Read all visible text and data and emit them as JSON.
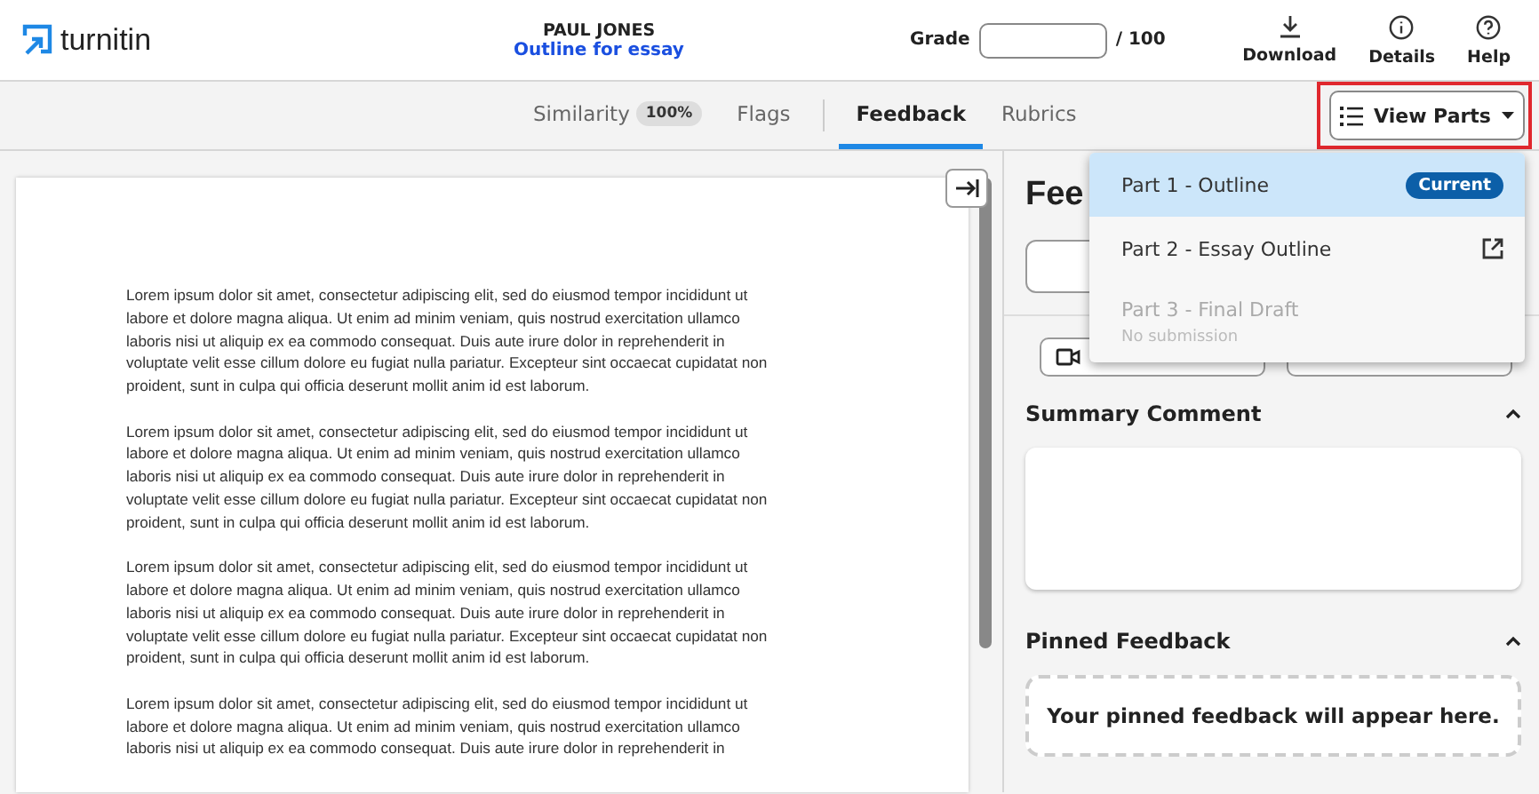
{
  "header": {
    "logo": "turnitin",
    "student": "PAUL JONES",
    "assignment": "Outline for essay",
    "grade_label": "Grade",
    "grade_max": "/ 100",
    "actions": [
      {
        "kind": "download",
        "label": "Download"
      },
      {
        "kind": "details",
        "label": "Details"
      },
      {
        "kind": "help",
        "label": "Help"
      }
    ]
  },
  "tabs": [
    {
      "label": "Similarity",
      "badge": "100%",
      "selected": false
    },
    {
      "label": "Flags",
      "selected": false
    },
    {
      "label": "Feedback",
      "selected": true
    },
    {
      "label": "Rubrics",
      "selected": false
    }
  ],
  "view_parts": {
    "label": "View Parts",
    "highlighted": true
  },
  "parts_menu": [
    {
      "label": "Part 1 - Outline",
      "selected": true,
      "disabled": false,
      "badge": "Current"
    },
    {
      "label": "Part 2 - Essay Outline",
      "selected": false,
      "disabled": false,
      "external": true
    },
    {
      "label": "Part 3 - Final Draft",
      "selected": false,
      "disabled": true,
      "note": "No submission"
    }
  ],
  "document": {
    "paragraphs": [
      {
        "lines": [
          "Lorem ipsum dolor sit amet, consectetur adipiscing elit, sed do eiusmod tempor incididunt ut",
          "labore et dolore magna aliqua. Ut enim ad minim veniam, quis nostrud exercitation ullamco",
          "laboris nisi ut aliquip ex ea commodo consequat. Duis aute irure dolor in reprehenderit in",
          "voluptate velit esse cillum dolore eu fugiat nulla pariatur. Excepteur sint occaecat cupidatat non",
          "proident, sunt in culpa qui officia deserunt mollit anim id est laborum."
        ]
      },
      {
        "lines": [
          "Lorem ipsum dolor sit amet, consectetur adipiscing elit, sed do eiusmod tempor incididunt ut",
          "labore et dolore magna aliqua. Ut enim ad minim veniam, quis nostrud exercitation ullamco",
          "laboris nisi ut aliquip ex ea commodo consequat. Duis aute irure dolor in reprehenderit in",
          "voluptate velit esse cillum dolore eu fugiat nulla pariatur. Excepteur sint occaecat cupidatat non",
          "proident, sunt in culpa qui officia deserunt mollit anim id est laborum."
        ]
      },
      {
        "lines": [
          "Lorem ipsum dolor sit amet, consectetur adipiscing elit, sed do eiusmod tempor incididunt ut",
          "labore et dolore magna aliqua. Ut enim ad minim veniam, quis nostrud exercitation ullamco",
          "laboris nisi ut aliquip ex ea commodo consequat. Duis aute irure dolor in reprehenderit in",
          "voluptate velit esse cillum dolore eu fugiat nulla pariatur. Excepteur sint occaecat cupidatat non",
          "proident, sunt in culpa qui officia deserunt mollit anim id est laborum."
        ]
      },
      {
        "lines": [
          "Lorem ipsum dolor sit amet, consectetur adipiscing elit, sed do eiusmod tempor incididunt ut",
          "labore et dolore magna aliqua. Ut enim ad minim veniam, quis nostrud exercitation ullamco",
          "laboris nisi ut aliquip ex ea commodo consequat. Duis aute irure dolor in reprehenderit in"
        ]
      }
    ]
  },
  "feedback_panel": {
    "title": "Fee",
    "sections": [
      {
        "title": "Summary Comment",
        "expanded": true,
        "kind": "comment"
      },
      {
        "title": "Pinned Feedback",
        "expanded": true,
        "kind": "pinned",
        "placeholder": "Your pinned feedback will appear here."
      }
    ]
  }
}
